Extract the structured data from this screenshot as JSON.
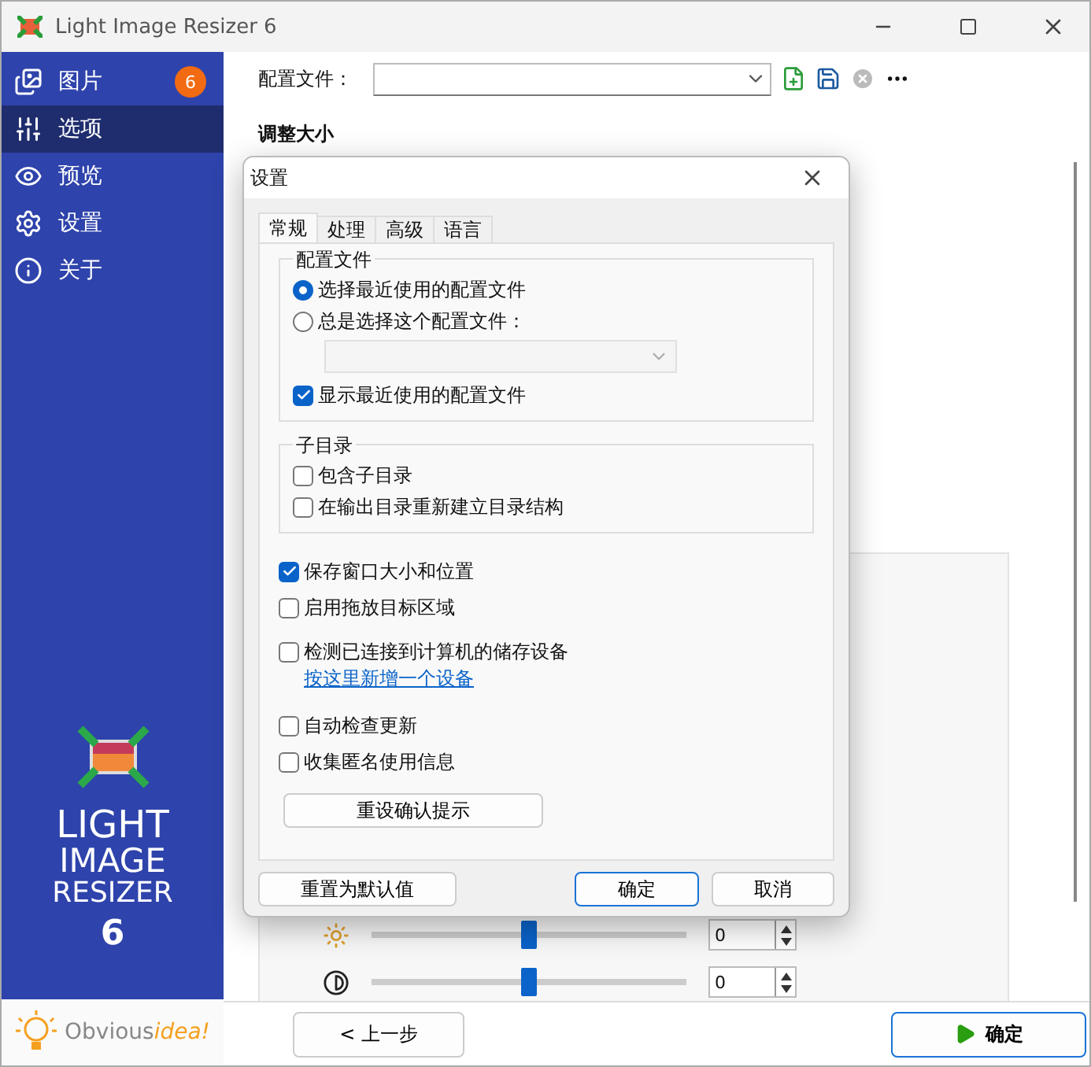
{
  "window": {
    "title": "Light Image Resizer 6"
  },
  "sidebar": {
    "items": [
      {
        "label": "图片",
        "selected": false,
        "badge": "6"
      },
      {
        "label": "选项",
        "selected": true
      },
      {
        "label": "预览",
        "selected": false
      },
      {
        "label": "设置",
        "selected": false
      },
      {
        "label": "关于",
        "selected": false
      }
    ],
    "logo_lines": [
      "LIGHT",
      "IMAGE",
      "RESIZER",
      "6"
    ],
    "brand": {
      "part_1": "Obvious",
      "part_2": "idea!"
    }
  },
  "main": {
    "profile_label": "配置文件：",
    "section_heading": "调整大小",
    "adjustments": [
      {
        "kind": "brightness",
        "level": 0.5,
        "value": "0"
      },
      {
        "kind": "contrast",
        "level": 0.5,
        "value": "0"
      }
    ],
    "back_button": "< 上一步",
    "next_button": "确定"
  },
  "dialog": {
    "title": "设置",
    "tabs": [
      {
        "label": "常规",
        "selected": true
      },
      {
        "label": "处理",
        "selected": false
      },
      {
        "label": "高级",
        "selected": false
      },
      {
        "label": "语言",
        "selected": false
      }
    ],
    "profile_group": {
      "title": "配置文件",
      "radios": [
        {
          "label": "选择最近使用的配置文件",
          "selected": true
        },
        {
          "label": "总是选择这个配置文件：",
          "selected": false
        }
      ],
      "dropdown_disabled": true,
      "checkbox": {
        "label": "显示最近使用的配置文件",
        "checked": true
      }
    },
    "subdir_group": {
      "title": "子目录",
      "checkboxes": [
        {
          "label": "包含子目录",
          "checked": false
        },
        {
          "label": "在输出目录重新建立目录结构",
          "checked": false
        }
      ]
    },
    "options": [
      {
        "kind": "checkbox",
        "label": "保存窗口大小和位置",
        "checked": true
      },
      {
        "kind": "checkbox",
        "label": "启用拖放目标区域",
        "checked": false
      },
      {
        "kind": "checkbox",
        "label": "检测已连接到计算机的储存设备",
        "checked": false
      },
      {
        "kind": "link",
        "label": "按这里新增一个设备"
      },
      {
        "kind": "checkbox",
        "label": "自动检查更新",
        "checked": false
      },
      {
        "kind": "checkbox",
        "label": "收集匿名使用信息",
        "checked": false
      }
    ],
    "reset_prompts_button": "重设确认提示",
    "buttons": [
      {
        "label": "重置为默认值",
        "default": false
      },
      {
        "label": "确定",
        "default": true
      },
      {
        "label": "取消",
        "default": false
      }
    ]
  }
}
